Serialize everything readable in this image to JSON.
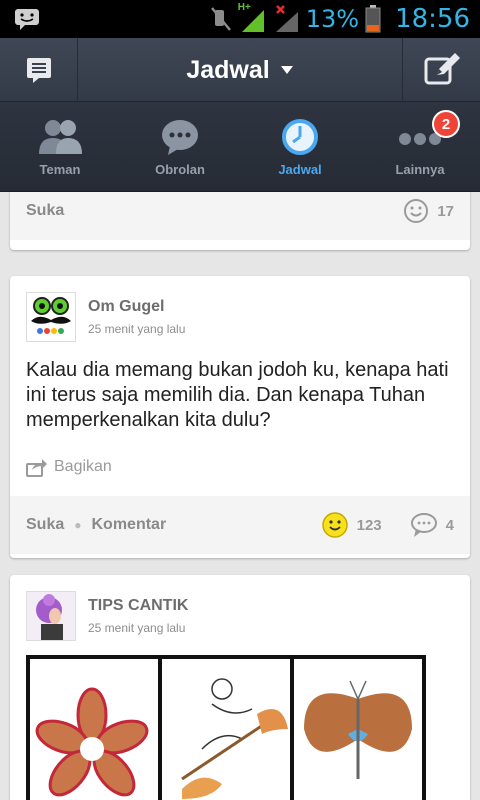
{
  "statusbar": {
    "battery_percent": "13%",
    "time": "18:56",
    "network_label": "H+",
    "icons": [
      "notification-icon",
      "mute-icon",
      "signal-icon",
      "battery-icon"
    ]
  },
  "appbar": {
    "title": "Jadwal",
    "left_icon": "menu-note-icon",
    "right_icon": "compose-icon"
  },
  "tabs": [
    {
      "label": "Teman",
      "icon": "friends-icon",
      "active": false
    },
    {
      "label": "Obrolan",
      "icon": "chat-icon",
      "active": false
    },
    {
      "label": "Jadwal",
      "icon": "clock-icon",
      "active": true
    },
    {
      "label": "Lainnya",
      "icon": "more-icon",
      "active": false,
      "badge": "2"
    }
  ],
  "feed": {
    "prev_card": {
      "like_label": "Suka",
      "like_count": "17"
    },
    "post1": {
      "author": "Om Gugel",
      "time": "25 menit yang lalu",
      "text": "Kalau dia memang bukan jodoh ku, kenapa hati ini terus saja memilih dia. Dan kenapa Tuhan memperkenalkan kita dulu?",
      "share_label": "Bagikan",
      "like_label": "Suka",
      "comment_label": "Komentar",
      "like_count": "123",
      "comment_count": "4"
    },
    "post2": {
      "author": "TIPS CANTIK",
      "time": "25 menit yang lalu"
    }
  },
  "colors": {
    "accent": "#4aa8f0",
    "status_blue": "#33b5e5",
    "badge_red": "#f04438",
    "appbar": "#3a414f"
  }
}
